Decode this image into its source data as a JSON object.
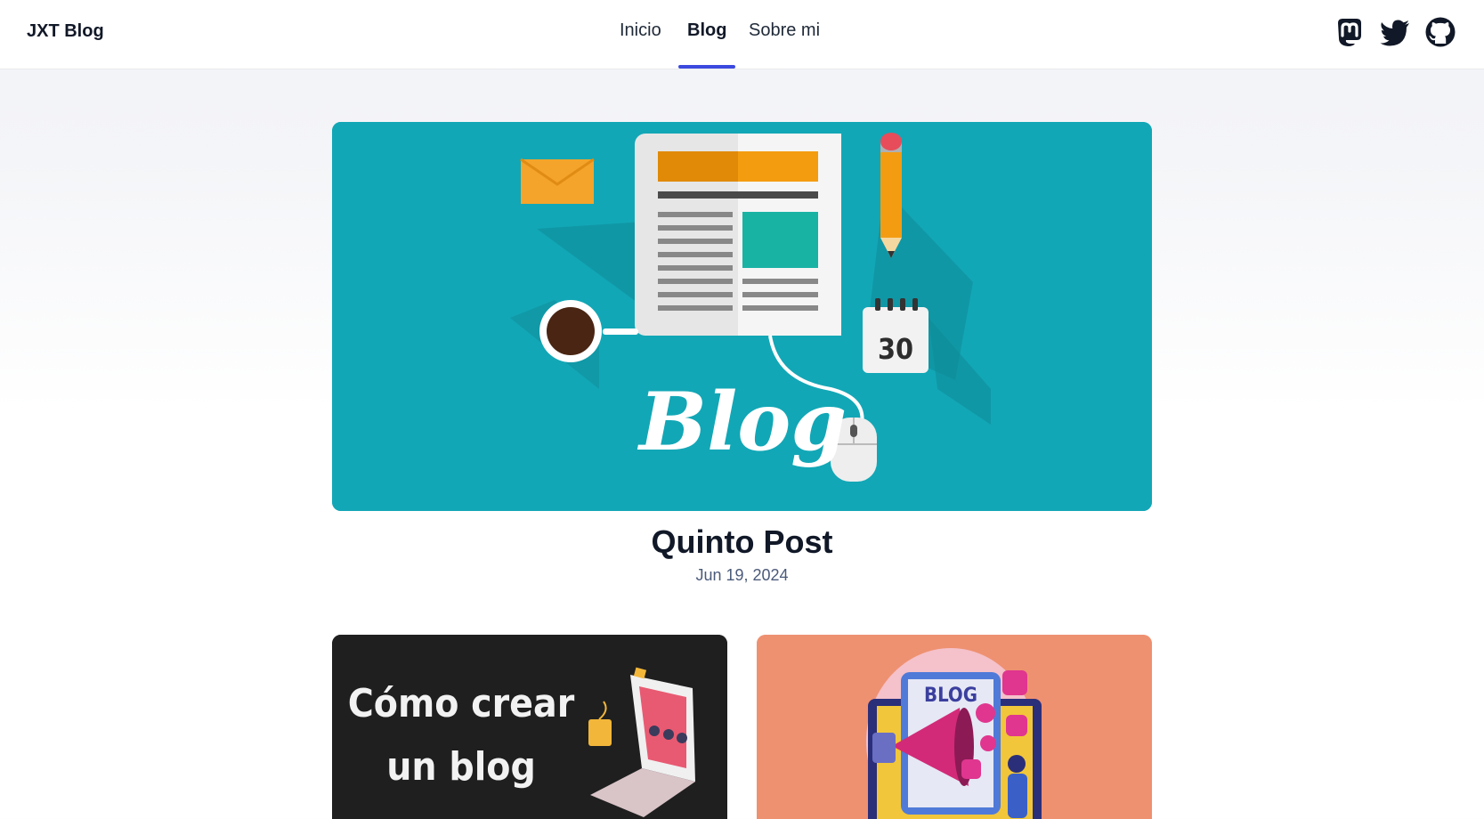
{
  "header": {
    "brand": "JXT Blog",
    "nav": [
      {
        "label": "Inicio",
        "active": false
      },
      {
        "label": "Blog",
        "active": true
      },
      {
        "label": "Sobre mi",
        "active": false
      }
    ],
    "social_icons": [
      "mastodon-icon",
      "twitter-icon",
      "github-icon"
    ],
    "accent_color": "#3b49df"
  },
  "featured_post": {
    "title": "Quinto Post",
    "date": "Jun 19, 2024",
    "image": {
      "lettering": "Blog",
      "calendar_day": "30",
      "background": "#12a7b6"
    }
  },
  "posts": [
    {
      "image": {
        "lettering_line1": "Cómo crear",
        "lettering_line2": "un blog",
        "background": "#1f1f1f"
      }
    },
    {
      "image": {
        "lettering": "BLOG",
        "background": "#ee9171"
      }
    }
  ]
}
